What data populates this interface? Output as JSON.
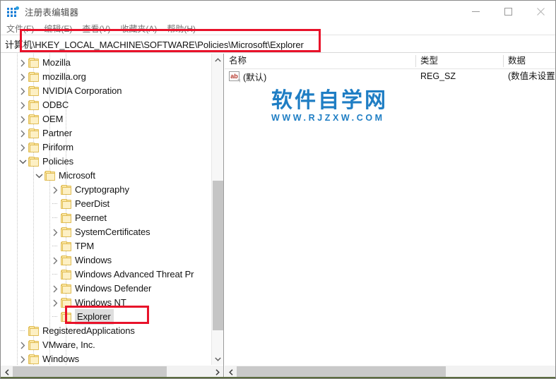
{
  "window": {
    "title": "注册表编辑器",
    "icon": "registry-editor-icon",
    "controls": {
      "minimize": "minimize-icon",
      "maximize": "maximize-icon",
      "close": "close-icon"
    }
  },
  "menubar": {
    "items": [
      {
        "label": "文件(F)"
      },
      {
        "label": "编辑(E)"
      },
      {
        "label": "查看(V)"
      },
      {
        "label": "收藏夹(A)"
      },
      {
        "label": "帮助(H)"
      }
    ]
  },
  "address": {
    "value": "计算机\\HKEY_LOCAL_MACHINE\\SOFTWARE\\Policies\\Microsoft\\Explorer",
    "placeholder": ""
  },
  "annotations": {
    "color": "#e8122a",
    "boxes": [
      {
        "name": "address-path-highlight"
      },
      {
        "name": "explorer-key-highlight"
      }
    ]
  },
  "tree": {
    "items": [
      {
        "label": "Mozilla",
        "depth": 1,
        "expander": "collapsed",
        "selected": false
      },
      {
        "label": "mozilla.org",
        "depth": 1,
        "expander": "collapsed",
        "selected": false
      },
      {
        "label": "NVIDIA Corporation",
        "depth": 1,
        "expander": "collapsed",
        "selected": false
      },
      {
        "label": "ODBC",
        "depth": 1,
        "expander": "collapsed",
        "selected": false
      },
      {
        "label": "OEM",
        "depth": 1,
        "expander": "collapsed",
        "selected": false
      },
      {
        "label": "Partner",
        "depth": 1,
        "expander": "collapsed",
        "selected": false
      },
      {
        "label": "Piriform",
        "depth": 1,
        "expander": "collapsed",
        "selected": false
      },
      {
        "label": "Policies",
        "depth": 1,
        "expander": "expanded",
        "selected": false
      },
      {
        "label": "Microsoft",
        "depth": 2,
        "expander": "expanded",
        "selected": false
      },
      {
        "label": "Cryptography",
        "depth": 3,
        "expander": "collapsed",
        "selected": false
      },
      {
        "label": "PeerDist",
        "depth": 3,
        "expander": "leaf",
        "selected": false
      },
      {
        "label": "Peernet",
        "depth": 3,
        "expander": "leaf",
        "selected": false
      },
      {
        "label": "SystemCertificates",
        "depth": 3,
        "expander": "collapsed",
        "selected": false
      },
      {
        "label": "TPM",
        "depth": 3,
        "expander": "leaf",
        "selected": false
      },
      {
        "label": "Windows",
        "depth": 3,
        "expander": "collapsed",
        "selected": false
      },
      {
        "label": "Windows Advanced Threat Pr",
        "depth": 3,
        "expander": "leaf",
        "selected": false
      },
      {
        "label": "Windows Defender",
        "depth": 3,
        "expander": "collapsed",
        "selected": false
      },
      {
        "label": "Windows NT",
        "depth": 3,
        "expander": "collapsed",
        "selected": false
      },
      {
        "label": "Explorer",
        "depth": 3,
        "expander": "leaf",
        "selected": true
      },
      {
        "label": "RegisteredApplications",
        "depth": 1,
        "expander": "leaf",
        "selected": false
      },
      {
        "label": "VMware, Inc.",
        "depth": 1,
        "expander": "collapsed",
        "selected": false
      },
      {
        "label": "Windows",
        "depth": 1,
        "expander": "collapsed",
        "selected": false
      }
    ]
  },
  "values": {
    "columns": [
      {
        "label": "名称"
      },
      {
        "label": "类型"
      },
      {
        "label": "数据"
      }
    ],
    "rows": [
      {
        "icon": "string-value-icon",
        "icon_text": "ab",
        "name": "(默认)",
        "type": "REG_SZ",
        "data": "(数值未设置"
      }
    ]
  },
  "watermark": {
    "main": "软件自学网",
    "sub": "WWW.RJZXW.COM",
    "color": "#1f7ec4"
  },
  "scrollbars": {
    "tree_vertical": {
      "up": "scroll-up-icon",
      "down": "scroll-down-icon"
    },
    "tree_horizontal": {
      "left": "scroll-left-icon",
      "right": "scroll-right-icon"
    },
    "values_horizontal": {
      "left": "scroll-left-icon",
      "right": "scroll-right-icon"
    }
  }
}
